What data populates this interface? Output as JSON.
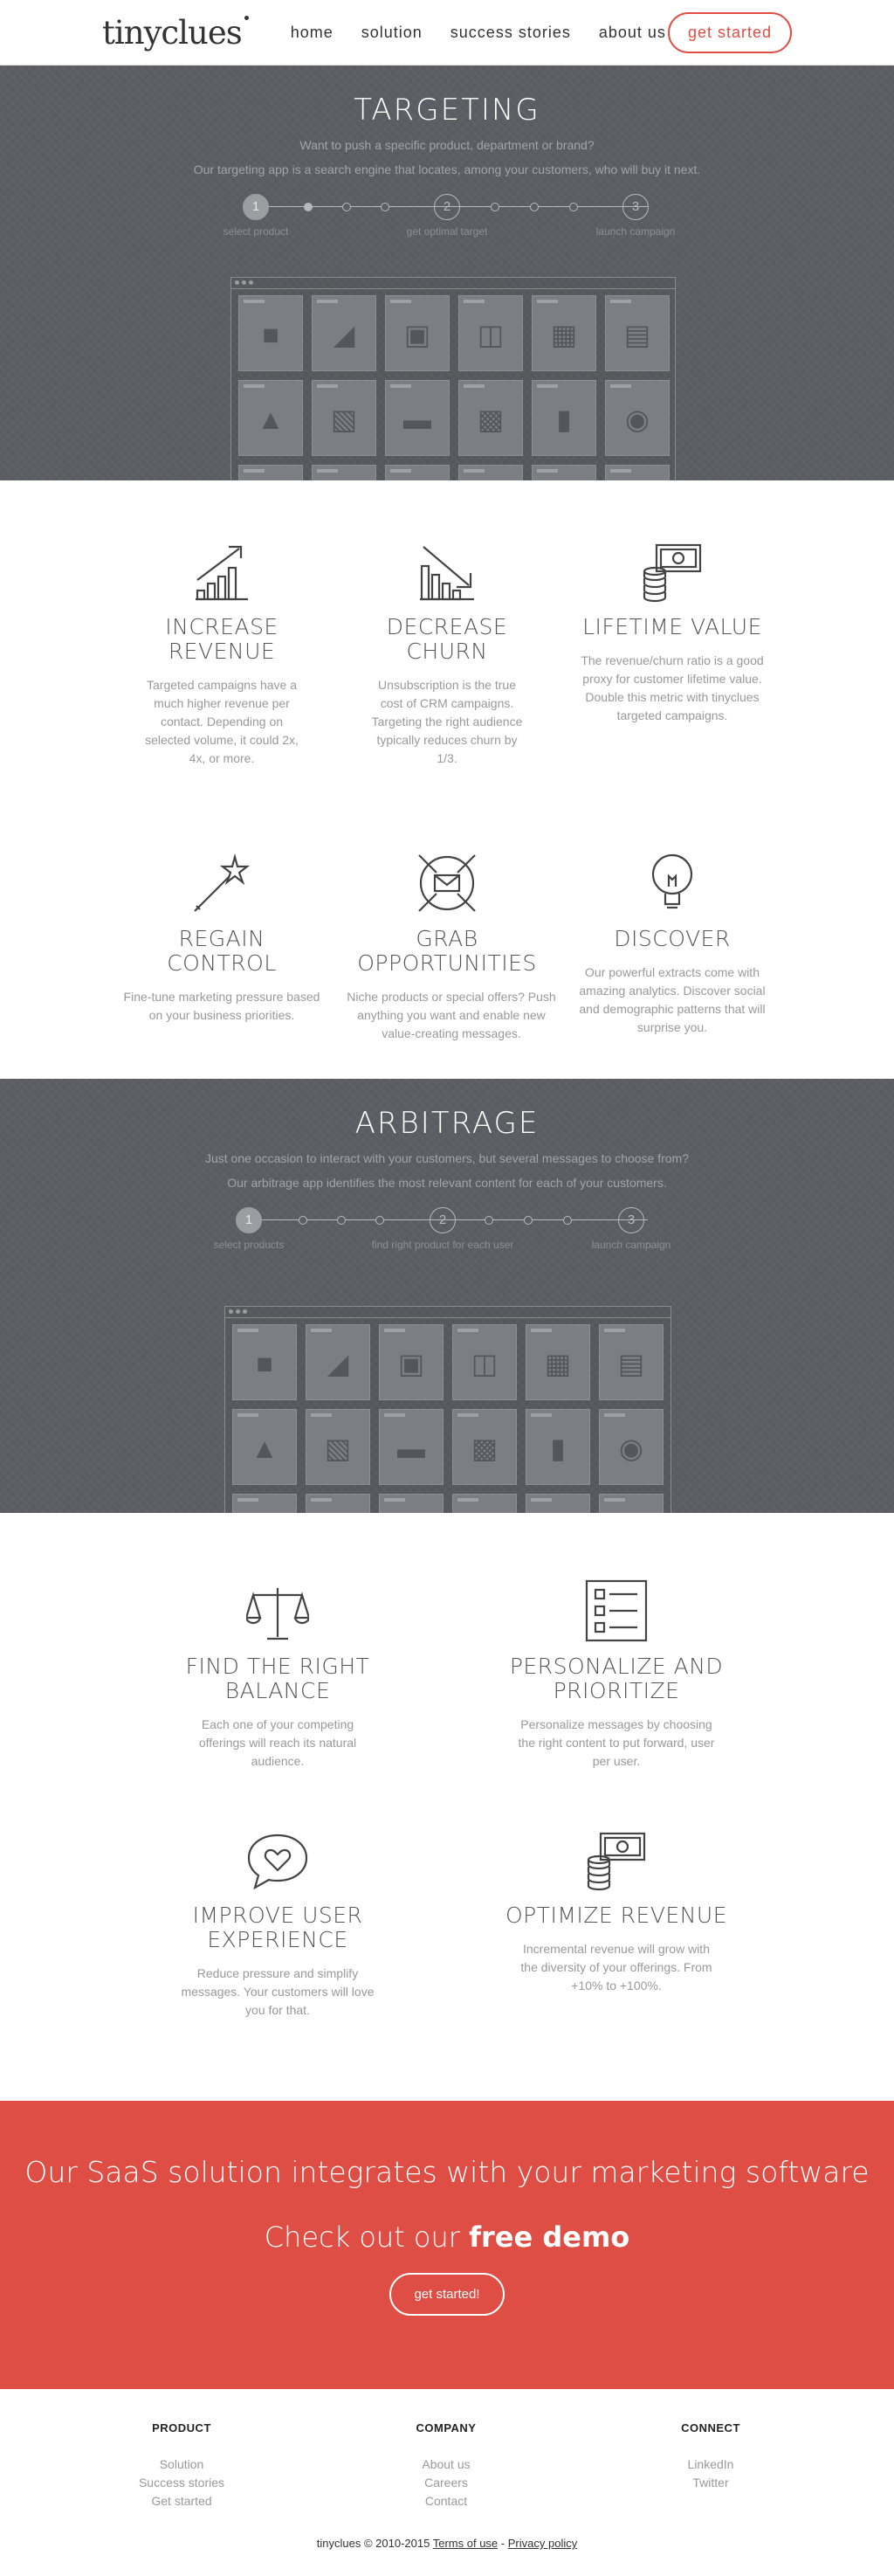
{
  "header": {
    "logo": "tinyclues",
    "menu": [
      "home",
      "solution",
      "success stories",
      "about us"
    ],
    "cta": "get started"
  },
  "targeting": {
    "title": "TARGETING",
    "line1": "Want to push a specific product, department or brand?",
    "line2": "Our targeting app is a search engine that locates, among your customers, who will buy it next.",
    "steps": [
      "1",
      "2",
      "3"
    ],
    "step_labels": [
      "select product",
      "get optimal target",
      "launch campaign"
    ],
    "cards": [
      "bag-icon",
      "tie-icon",
      "game-icon",
      "radio-icon",
      "luggage-icon",
      "cassette-icon",
      "cap-icon",
      "handbag-icon",
      "stapler-icon",
      "toaster-icon",
      "sd-card-icon",
      "gamepad-icon"
    ]
  },
  "benefits": [
    {
      "icon": "chart-up-icon",
      "title": "INCREASE REVENUE",
      "text": "Targeted campaigns have a much higher revenue per contact. Depending on selected volume, it could 2x, 4x, or more."
    },
    {
      "icon": "chart-down-icon",
      "title": "DECREASE CHURN",
      "text": "Unsubscription is the true cost of CRM campaigns. Targeting the right audience typically reduces churn by 1/3."
    },
    {
      "icon": "money-icon",
      "title": "LIFETIME VALUE",
      "text": "The revenue/churn ratio is a good proxy for customer lifetime value. Double this metric with tinyclues targeted campaigns."
    },
    {
      "icon": "magic-wand-icon",
      "title": "REGAIN CONTROL",
      "text": "Fine-tune marketing pressure based on your business priorities."
    },
    {
      "icon": "envelope-target-icon",
      "title": "GRAB OPPORTUNITIES",
      "text": "Niche products or special offers? Push anything you want and enable new value-creating messages."
    },
    {
      "icon": "lightbulb-icon",
      "title": "DISCOVER",
      "text": "Our powerful extracts come with amazing analytics. Discover social and demographic patterns that will surprise you."
    }
  ],
  "arbitrage": {
    "title": "ARBITRAGE",
    "line1": "Just one occasion to interact with your customers, but several messages to choose from?",
    "line2": "Our arbitrage app identifies the most relevant content for each of your customers.",
    "steps": [
      "1",
      "2",
      "3"
    ],
    "step_labels": [
      "select products",
      "find right product for each user",
      "launch campaign"
    ]
  },
  "benefits2": [
    {
      "icon": "scales-icon",
      "title": "FIND THE RIGHT BALANCE",
      "text": "Each one of your competing offerings will reach its natural audience."
    },
    {
      "icon": "list-icon",
      "title": "PERSONALIZE AND PRIORITIZE",
      "text": "Personalize messages by choosing the right content to put forward, user per user."
    },
    {
      "icon": "heart-bubble-icon",
      "title": "IMPROVE USER EXPERIENCE",
      "text": "Reduce pressure and simplify messages. Your customers will love you for that."
    },
    {
      "icon": "money-icon",
      "title": "OPTIMIZE REVENUE",
      "text": "Incremental revenue will grow with the diversity of your offerings. From +10% to +100%."
    }
  ],
  "banner": {
    "title": "Our SaaS solution integrates with your marketing software",
    "sub": "Check out our",
    "sub_bold": "free demo",
    "button": "get started!"
  },
  "footer": {
    "cols": [
      {
        "title": "PRODUCT",
        "links": [
          "Solution",
          "Success stories",
          "Get started"
        ]
      },
      {
        "title": "COMPANY",
        "links": [
          "About us",
          "Careers",
          "Contact"
        ]
      },
      {
        "title": "CONNECT",
        "links": [
          "LinkedIn",
          "Twitter"
        ]
      }
    ],
    "copy": "tinyclues © 2010-2015",
    "terms": "Terms of use",
    "sep": "-",
    "privacy": "Privacy policy"
  }
}
